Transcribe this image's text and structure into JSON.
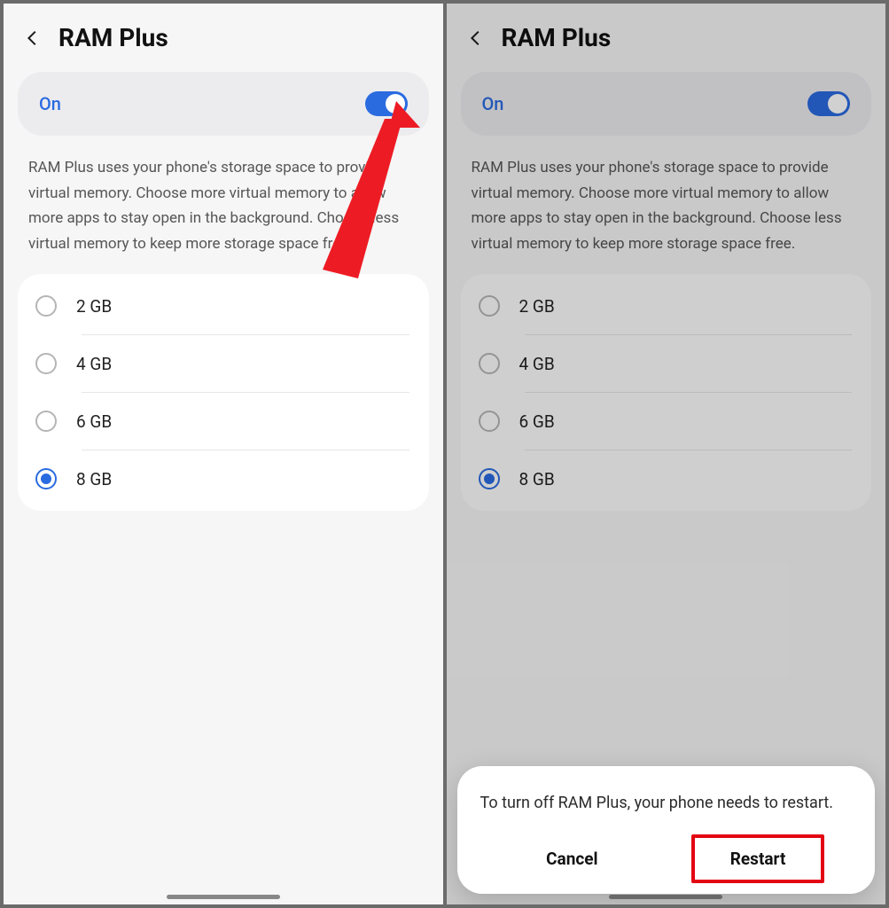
{
  "left": {
    "header": {
      "title": "RAM Plus"
    },
    "toggle": {
      "label": "On",
      "checked": true
    },
    "description": "RAM Plus uses your phone's storage space to provide virtual memory. Choose more virtual memory to allow more apps to stay open in the background. Choose less virtual memory to keep more storage space free.",
    "options": [
      {
        "label": "2 GB",
        "checked": false
      },
      {
        "label": "4 GB",
        "checked": false
      },
      {
        "label": "6 GB",
        "checked": false
      },
      {
        "label": "8 GB",
        "checked": true
      }
    ]
  },
  "right": {
    "header": {
      "title": "RAM Plus"
    },
    "toggle": {
      "label": "On",
      "checked": true
    },
    "description": "RAM Plus uses your phone's storage space to provide virtual memory. Choose more virtual memory to allow more apps to stay open in the background. Choose less virtual memory to keep more storage space free.",
    "options": [
      {
        "label": "2 GB",
        "checked": false
      },
      {
        "label": "4 GB",
        "checked": false
      },
      {
        "label": "6 GB",
        "checked": false
      },
      {
        "label": "8 GB",
        "checked": true
      }
    ],
    "popup": {
      "message": "To turn off RAM Plus, your phone needs to restart.",
      "cancel": "Cancel",
      "confirm": "Restart"
    }
  },
  "annotations": {
    "arrow_color": "#ed1c24",
    "highlight_color": "#e30513"
  }
}
